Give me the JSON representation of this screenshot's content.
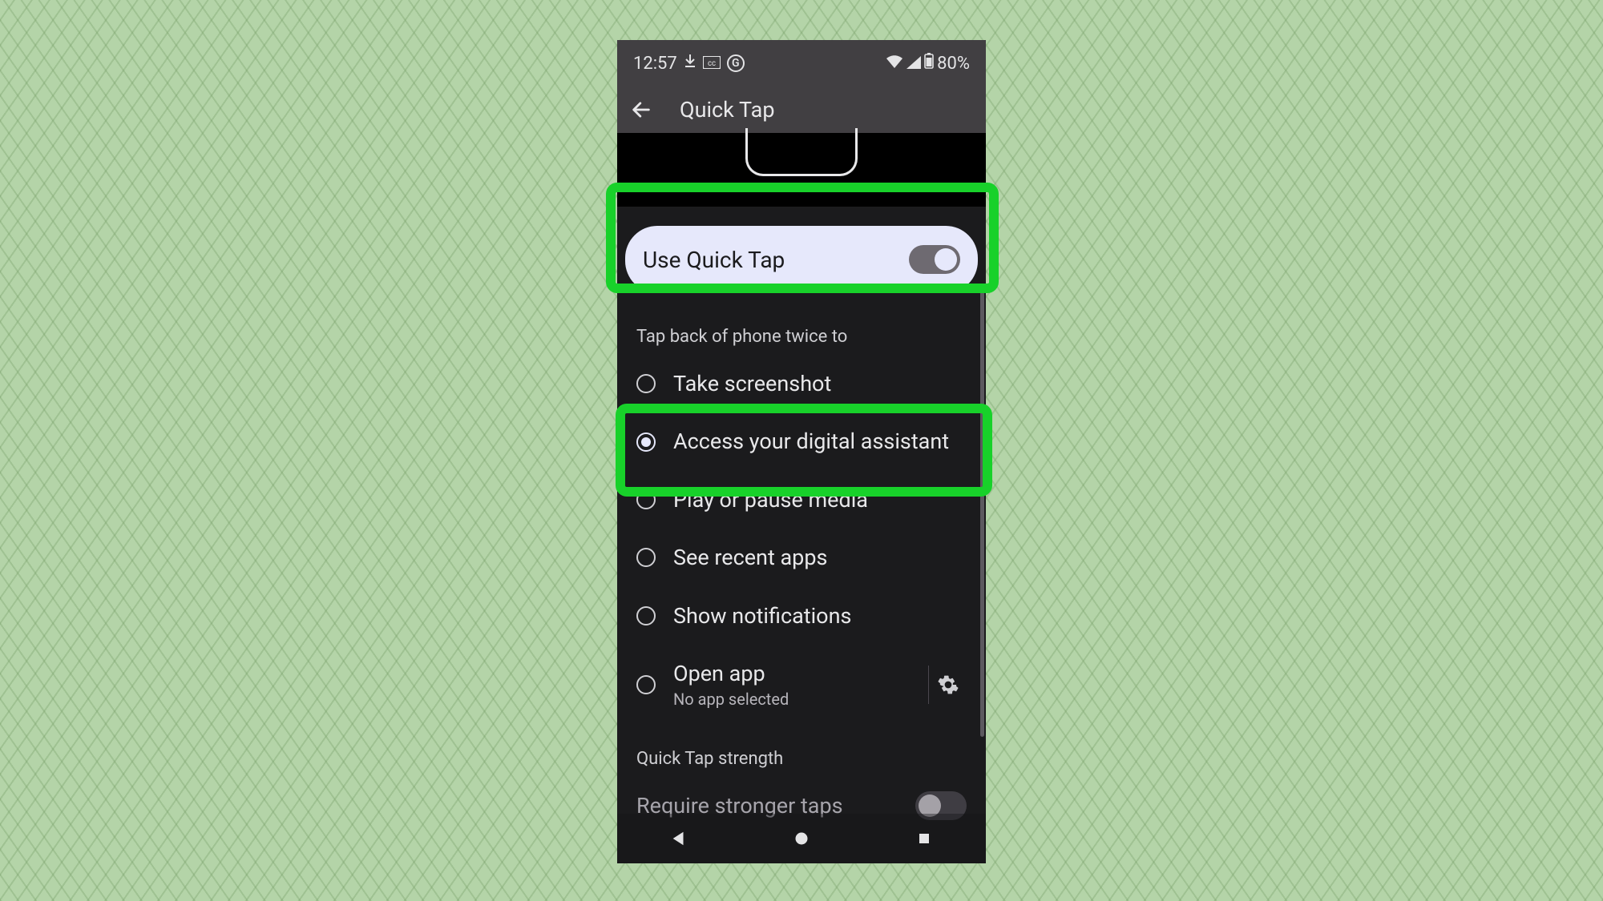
{
  "status": {
    "time": "12:57",
    "battery": "80%",
    "google_glyph": "G"
  },
  "header": {
    "title": "Quick Tap"
  },
  "toggle": {
    "label": "Use Quick Tap",
    "on": true
  },
  "section1_title": "Tap back of phone twice to",
  "options": [
    {
      "id": "screenshot",
      "label": "Take screenshot",
      "selected": false
    },
    {
      "id": "assistant",
      "label": "Access your digital assistant",
      "selected": true
    },
    {
      "id": "media",
      "label": "Play or pause media",
      "selected": false
    },
    {
      "id": "recent",
      "label": "See recent apps",
      "selected": false
    },
    {
      "id": "notifications",
      "label": "Show notifications",
      "selected": false
    },
    {
      "id": "openapp",
      "label": "Open app",
      "sub": "No app selected",
      "gear": true,
      "selected": false
    }
  ],
  "section2_title": "Quick Tap strength",
  "require": {
    "label": "Require stronger taps",
    "on": false
  }
}
